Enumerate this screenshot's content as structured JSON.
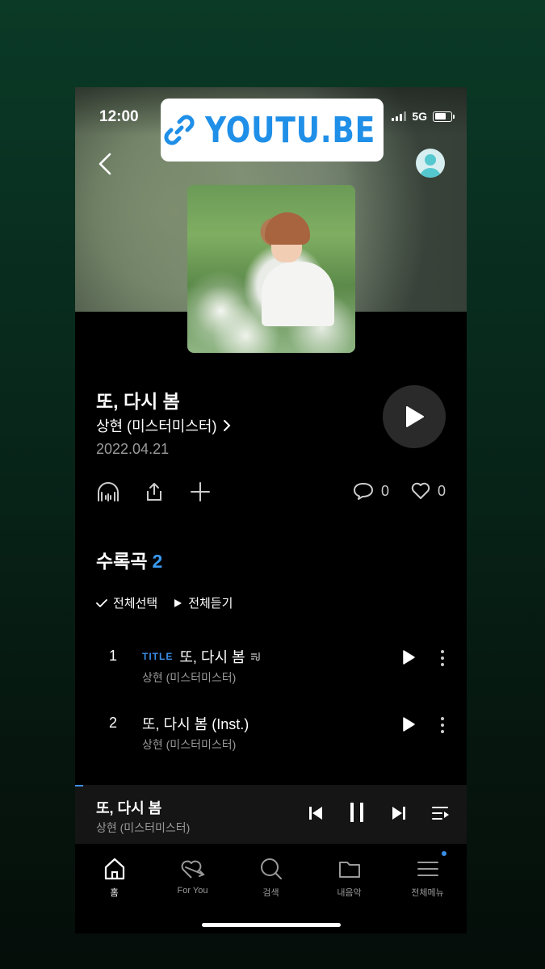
{
  "status_bar": {
    "time": "12:00",
    "network": "5G"
  },
  "link_sticker": {
    "text": "YOUTU.BE",
    "icon": "link-icon"
  },
  "header": {
    "back_icon": "chevron-left-icon",
    "profile_icon": "avatar"
  },
  "album": {
    "title": "또, 다시 봄",
    "artist": "상현 (미스터미스터)",
    "date": "2022.04.21"
  },
  "actions": {
    "comments_count": "0",
    "likes_count": "0"
  },
  "tracklist": {
    "heading": "수록곡",
    "count": "2",
    "select_all": "전체선택",
    "play_all": "전체듣기",
    "tracks": [
      {
        "number": "1",
        "badge": "TITLE",
        "title": "또, 다시 봄",
        "artist": "상현 (미스터미스터)"
      },
      {
        "number": "2",
        "badge": "",
        "title": "또, 다시 봄 (Inst.)",
        "artist": "상현 (미스터미스터)"
      }
    ]
  },
  "mini_player": {
    "title": "또, 다시 봄",
    "artist": "상현 (미스터미스터)",
    "progress": 0.02
  },
  "tabs": [
    {
      "label": "홈",
      "icon": "home-icon",
      "active": true
    },
    {
      "label": "For You",
      "icon": "heart-arrow-icon",
      "active": false
    },
    {
      "label": "검색",
      "icon": "search-icon",
      "active": false
    },
    {
      "label": "내음악",
      "icon": "folder-icon",
      "active": false
    },
    {
      "label": "전체메뉴",
      "icon": "menu-icon",
      "active": false
    }
  ],
  "colors": {
    "accent": "#3a8ee8",
    "background": "#000000"
  }
}
